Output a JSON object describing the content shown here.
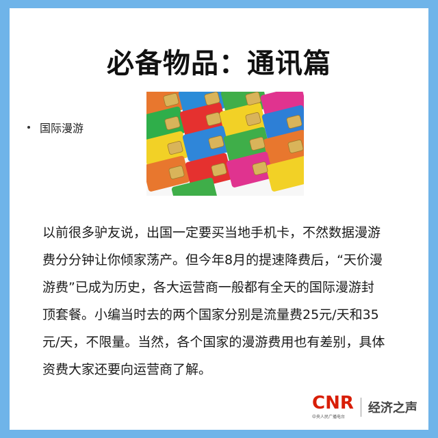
{
  "title": "必备物品：通讯篇",
  "bullet": {
    "label": "国际漫游"
  },
  "image": {
    "alt": "sim-cards-photo"
  },
  "body": {
    "lines": [
      "以前很多驴友说，出国一定要买当地手机卡，不然数据漫游",
      "费分分钟让你倾家荡产。但今年8月的提速降费后，“天价漫",
      "游费”已成为历史，各大运营商一般都有全天的国际漫游封",
      "顶套餐。小编当时去的两个国家分别是流量费25元/天和35",
      "元/天，不限量。当然，各个国家的漫游费用也有差别，具体",
      "资费大家还要向运营商了解。"
    ]
  },
  "logo": {
    "mark": "CNR",
    "sub": "中央人民广播电台",
    "name": "经济之声"
  },
  "colors": {
    "frame": "#6fb4e9",
    "brand_red": "#d81e06"
  }
}
